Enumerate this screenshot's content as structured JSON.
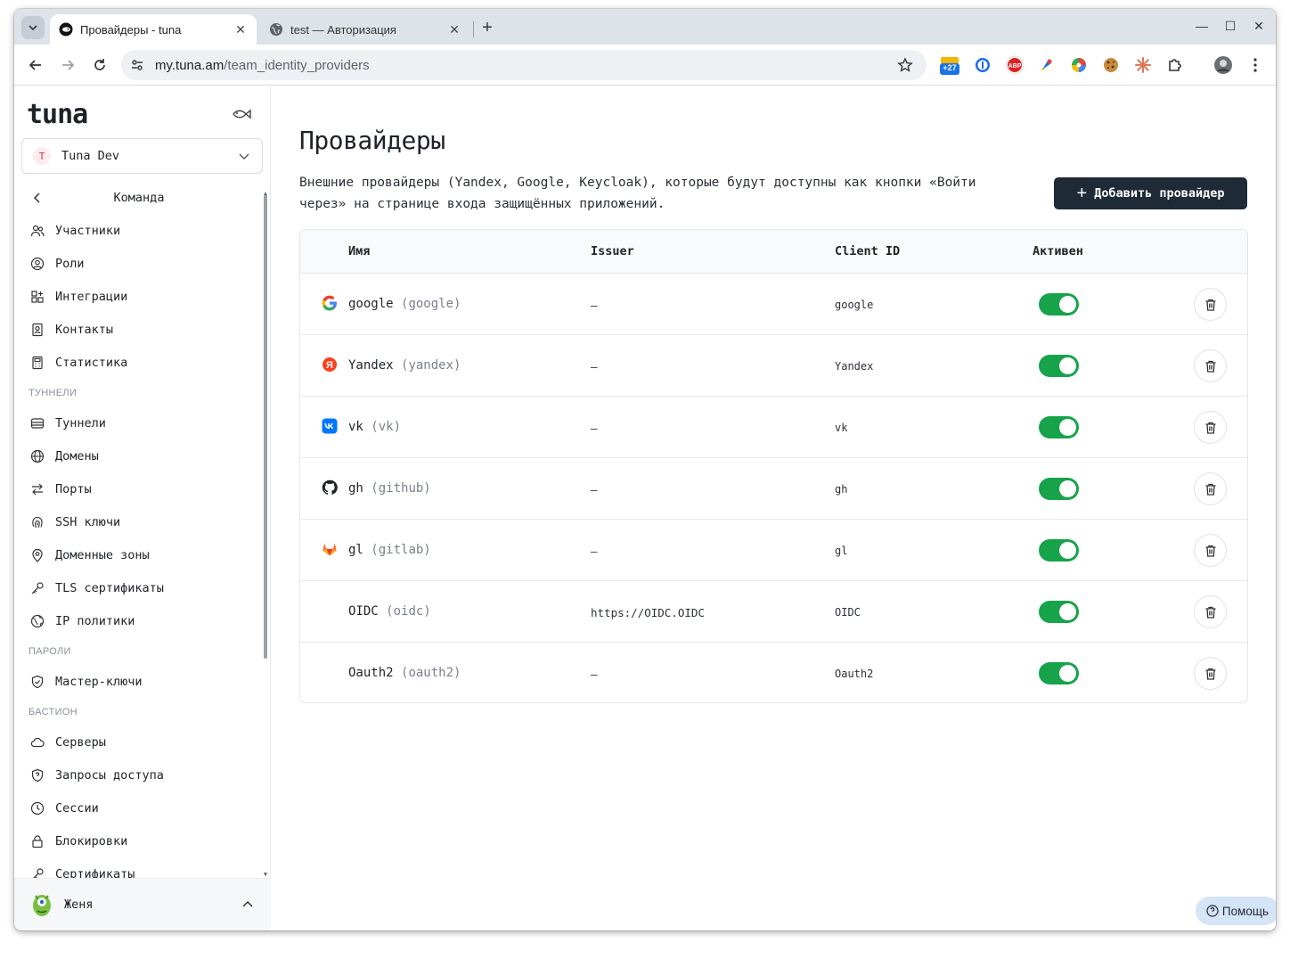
{
  "browser": {
    "tabs": [
      {
        "title": "Провайдеры - tuna",
        "active": true
      },
      {
        "title": "test — Авторизация",
        "active": false
      }
    ],
    "url_host": "my.tuna.am",
    "url_path": "/team_identity_providers",
    "extensions": [
      "calendar-badge-icon",
      "1password-icon",
      "adblock-icon",
      "color-picker-icon",
      "colorwheel-icon",
      "cookie-icon",
      "claude-icon",
      "puzzle-icon",
      "profile-icon"
    ],
    "calendar_badge": "+27"
  },
  "sidebar": {
    "logo": "tuna",
    "team": {
      "initial": "T",
      "name": "Tuna Dev"
    },
    "back_label": "Команда",
    "team_items": [
      {
        "label": "Участники",
        "icon": "users-icon"
      },
      {
        "label": "Роли",
        "icon": "user-circle-icon"
      },
      {
        "label": "Интеграции",
        "icon": "puzzle-icon"
      },
      {
        "label": "Контакты",
        "icon": "contact-book-icon"
      },
      {
        "label": "Статистика",
        "icon": "calculator-icon"
      }
    ],
    "sections": {
      "tunnels": "ТУННЕЛИ",
      "passwords": "ПАРОЛИ",
      "bastion": "БАСТИОН"
    },
    "tunnel_items": [
      {
        "label": "Туннели",
        "icon": "server-stack-icon"
      },
      {
        "label": "Домены",
        "icon": "globe-icon"
      },
      {
        "label": "Порты",
        "icon": "arrows-exchange-icon"
      },
      {
        "label": "SSH ключи",
        "icon": "fingerprint-icon"
      },
      {
        "label": "Доменные зоны",
        "icon": "map-pin-icon"
      },
      {
        "label": "TLS сертификаты",
        "icon": "key-icon"
      },
      {
        "label": "IP политики",
        "icon": "globe-shield-icon"
      }
    ],
    "password_items": [
      {
        "label": "Мастер-ключи",
        "icon": "shield-check-icon"
      }
    ],
    "bastion_items": [
      {
        "label": "Серверы",
        "icon": "cloud-icon"
      },
      {
        "label": "Запросы доступа",
        "icon": "shield-question-icon"
      },
      {
        "label": "Сессии",
        "icon": "clock-icon"
      },
      {
        "label": "Блокировки",
        "icon": "lock-icon"
      },
      {
        "label": "Сертификаты",
        "icon": "key-icon"
      }
    ],
    "user": {
      "name": "Женя"
    }
  },
  "main": {
    "title": "Провайдеры",
    "description": "Внешние провайдеры (Yandex, Google, Keycloak), которые будут доступны как кнопки «Войти через» на странице входа защищённых приложений.",
    "add_button": "Добавить провайдер",
    "columns": {
      "name": "Имя",
      "issuer": "Issuer",
      "client_id": "Client ID",
      "active": "Активен"
    },
    "providers": [
      {
        "name": "google",
        "slug": "(google)",
        "issuer": "—",
        "client_id": "google",
        "active": true,
        "icon": "google-icon"
      },
      {
        "name": "Yandex",
        "slug": "(yandex)",
        "issuer": "—",
        "client_id": "Yandex",
        "active": true,
        "icon": "yandex-icon"
      },
      {
        "name": "vk",
        "slug": "(vk)",
        "issuer": "—",
        "client_id": "vk",
        "active": true,
        "icon": "vk-icon"
      },
      {
        "name": "gh",
        "slug": "(github)",
        "issuer": "—",
        "client_id": "gh",
        "active": true,
        "icon": "github-icon"
      },
      {
        "name": "gl",
        "slug": "(gitlab)",
        "issuer": "—",
        "client_id": "gl",
        "active": true,
        "icon": "gitlab-icon"
      },
      {
        "name": "OIDC",
        "slug": "(oidc)",
        "issuer": "https://OIDC.OIDC",
        "client_id": "OIDC",
        "active": true,
        "icon": ""
      },
      {
        "name": "Oauth2",
        "slug": "(oauth2)",
        "issuer": "—",
        "client_id": "Oauth2",
        "active": true,
        "icon": ""
      }
    ],
    "help_button": "Помощь"
  },
  "colors": {
    "toggle_on": "#16a34a",
    "primary_button": "#1f2a37",
    "help_button_bg": "#d6e4f7"
  }
}
